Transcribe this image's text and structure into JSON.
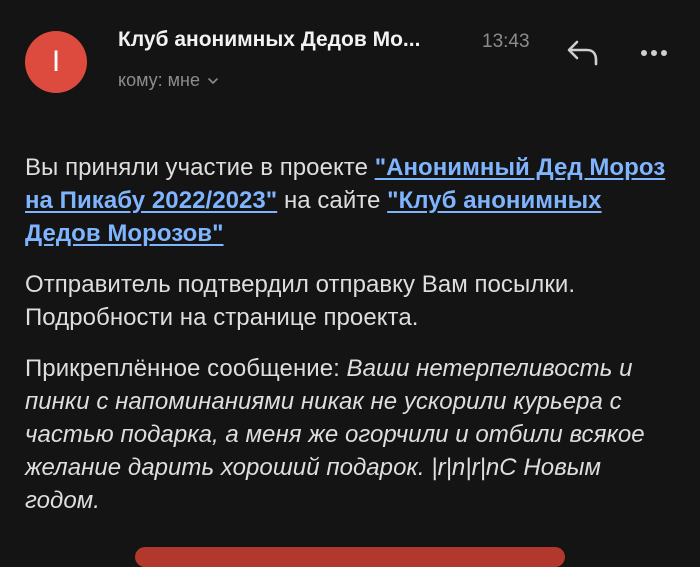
{
  "header": {
    "avatar_letter": "I",
    "sender": "Клуб анонимных Дедов Мо...",
    "time": "13:43",
    "recipient": "кому: мне"
  },
  "icons": {
    "reply": "reply-icon",
    "more": "more-horizontal-icon",
    "chevron": "chevron-down-icon"
  },
  "colors": {
    "background": "#141414",
    "avatar": "#dd4b3e",
    "link": "#7fb4ff",
    "text": "#dedede",
    "muted": "#8c8c8c"
  },
  "message": {
    "p1_before": "Вы приняли участие в проекте ",
    "p1_link1": "\"Анонимный Дед Мороз на Пикабу 2022/2023\"",
    "p1_middle": " на сайте ",
    "p1_link2": "\"Клуб анонимных Дедов Морозов\"",
    "p2": "Отправитель подтвердил отправку Вам посылки. Подробности на странице проекта.",
    "p3_label": "Прикреплённое сообщение: ",
    "p3_text": "Ваши нетерпеливость и пинки с напоминаниями никак не ускорили курьера с частью подарка, а меня же огорчили и отбили всякое желание дарить хороший подарок. |r|n|r|nС Новым годом."
  }
}
